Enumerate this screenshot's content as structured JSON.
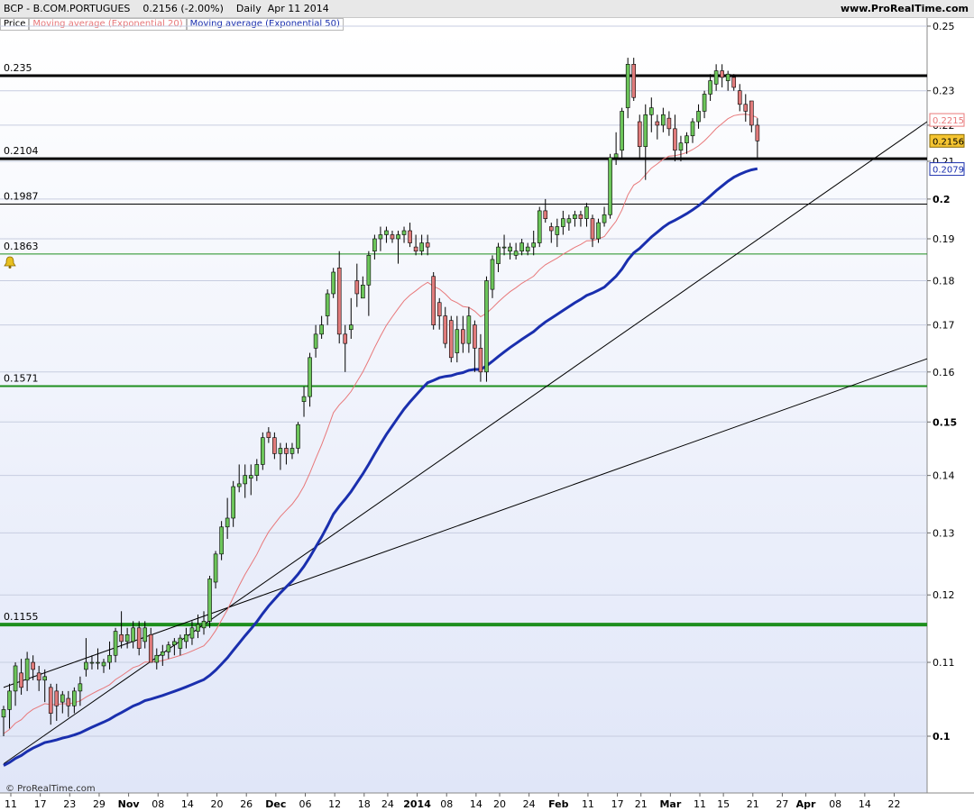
{
  "header": {
    "symbol": "BCP - B.COM.PORTUGUES",
    "last": "0.2156 (-2.00%)",
    "period": "Daily  Apr 11 2014",
    "site": "www.ProRealTime.com"
  },
  "legend": {
    "price": "Price",
    "ema20": "Moving average (Exponential 20)",
    "ema50": "Moving average (Exponential 50)"
  },
  "watermark": "© ProRealTime.com",
  "colors": {
    "bull": "#6cc55a",
    "bear": "#e07b7b",
    "ema20": "#e8787a",
    "ema50": "#1a2fae",
    "support": "#1e8f1e",
    "resistance": "#000000",
    "trendline": "#000000",
    "plot_bg_top": "#ffffff",
    "plot_bg_bottom": "#e0e6f8"
  },
  "chart_data": {
    "type": "candlestick",
    "scale": "log",
    "ylim": [
      0.095,
      0.25
    ],
    "y_ticks": [
      "0.25",
      "0.23",
      "0.22",
      "0.21",
      "0.2",
      "0.19",
      "0.18",
      "0.17",
      "0.16",
      "0.15",
      "0.14",
      "0.13",
      "0.12",
      "0.11",
      "0.1"
    ],
    "x_ticks": [
      "11",
      "17",
      "23",
      "29",
      "Nov",
      "08",
      "14",
      "20",
      "26",
      "Dec",
      "06",
      "12",
      "18",
      "24",
      "2014",
      "08",
      "14",
      "20",
      "24",
      "Feb",
      "11",
      "17",
      "21",
      "Mar",
      "11",
      "15",
      "21",
      "27",
      "Apr",
      "08",
      "14",
      "22"
    ],
    "x_ticks_major": [
      "Nov",
      "Dec",
      "2014",
      "Feb",
      "Mar",
      "Apr"
    ],
    "last_price": 0.2156,
    "ema20_last": 0.2215,
    "ema50_last": 0.2079,
    "levels": [
      {
        "label": "0.235",
        "value": 0.2345,
        "type": "resistance"
      },
      {
        "label": "0.2104",
        "value": 0.2107,
        "type": "resistance"
      },
      {
        "label": "0.1987",
        "value": 0.1987,
        "type": "resistance"
      },
      {
        "label": "0.1863",
        "value": 0.1863,
        "type": "support"
      },
      {
        "label": "0.1571",
        "value": 0.1571,
        "type": "support"
      },
      {
        "label": "0.1155",
        "value": 0.1155,
        "type": "support"
      }
    ],
    "trendlines": [
      {
        "from": [
          0,
          0.0965
        ],
        "to": [
          174,
          0.242
        ]
      },
      {
        "from": [
          0,
          0.1065
        ],
        "to": [
          174,
          0.1705
        ]
      }
    ],
    "tick_positions": [
      0,
      5,
      10,
      15,
      20,
      25,
      30,
      35,
      40,
      45,
      50,
      55,
      60,
      64,
      69,
      74,
      79,
      83,
      88,
      93,
      98,
      103,
      107,
      112,
      117,
      121,
      126,
      131,
      135,
      140,
      145,
      150
    ],
    "candles_series": [
      {
        "name": "Oct",
        "values": [
          [
            0.1025,
            0.104,
            0.1,
            0.1035
          ],
          [
            0.1035,
            0.107,
            0.101,
            0.106
          ],
          [
            0.106,
            0.11,
            0.104,
            0.1095
          ],
          [
            0.1085,
            0.1105,
            0.1055,
            0.1065
          ],
          [
            0.1075,
            0.1115,
            0.106,
            0.1105
          ],
          [
            0.11,
            0.111,
            0.1075,
            0.109
          ],
          [
            0.1085,
            0.1095,
            0.106,
            0.1075
          ],
          [
            0.1075,
            0.109,
            0.1045,
            0.108
          ],
          [
            0.1065,
            0.107,
            0.1015,
            0.103
          ],
          [
            0.106,
            0.107,
            0.102,
            0.104
          ],
          [
            0.1045,
            0.106,
            0.103,
            0.1055
          ],
          [
            0.105,
            0.106,
            0.1025,
            0.104
          ],
          [
            0.104,
            0.1065,
            0.103,
            0.106
          ],
          [
            0.106,
            0.108,
            0.104,
            0.107
          ]
        ]
      },
      {
        "name": "Nov",
        "values": [
          [
            0.109,
            0.1135,
            0.108,
            0.11
          ],
          [
            0.11,
            0.111,
            0.109,
            0.11
          ],
          [
            0.11,
            0.112,
            0.109,
            0.11
          ],
          [
            0.1095,
            0.1105,
            0.1085,
            0.11
          ],
          [
            0.11,
            0.113,
            0.109,
            0.111
          ],
          [
            0.111,
            0.115,
            0.11,
            0.1145
          ],
          [
            0.114,
            0.1175,
            0.112,
            0.113
          ],
          [
            0.113,
            0.115,
            0.112,
            0.114
          ],
          [
            0.113,
            0.116,
            0.112,
            0.115
          ],
          [
            0.115,
            0.116,
            0.111,
            0.112
          ],
          [
            0.113,
            0.116,
            0.112,
            0.115
          ],
          [
            0.114,
            0.115,
            0.11,
            0.11
          ],
          [
            0.11,
            0.112,
            0.109,
            0.111
          ],
          [
            0.111,
            0.1125,
            0.1095,
            0.1115
          ],
          [
            0.1115,
            0.113,
            0.1105,
            0.1125
          ],
          [
            0.1125,
            0.1135,
            0.111,
            0.113
          ],
          [
            0.112,
            0.114,
            0.111,
            0.1135
          ],
          [
            0.113,
            0.115,
            0.112,
            0.114
          ],
          [
            0.1135,
            0.116,
            0.1125,
            0.115
          ],
          [
            0.1145,
            0.117,
            0.1135,
            0.1155
          ],
          [
            0.115,
            0.1175,
            0.114,
            0.116
          ],
          [
            0.116,
            0.123,
            0.115,
            0.1225
          ]
        ]
      },
      {
        "name": "Dec",
        "values": [
          [
            0.122,
            0.127,
            0.121,
            0.1265
          ],
          [
            0.1265,
            0.132,
            0.1255,
            0.131
          ],
          [
            0.131,
            0.136,
            0.129,
            0.1325
          ],
          [
            0.1325,
            0.139,
            0.131,
            0.138
          ],
          [
            0.138,
            0.142,
            0.137,
            0.1385
          ],
          [
            0.1385,
            0.142,
            0.136,
            0.14
          ],
          [
            0.1395,
            0.142,
            0.1365,
            0.14
          ],
          [
            0.14,
            0.143,
            0.139,
            0.142
          ],
          [
            0.142,
            0.148,
            0.141,
            0.147
          ],
          [
            0.148,
            0.149,
            0.146,
            0.147
          ],
          [
            0.147,
            0.148,
            0.143,
            0.144
          ],
          [
            0.144,
            0.146,
            0.141,
            0.145
          ],
          [
            0.145,
            0.146,
            0.142,
            0.144
          ],
          [
            0.144,
            0.146,
            0.143,
            0.145
          ],
          [
            0.145,
            0.15,
            0.144,
            0.1495
          ],
          [
            0.154,
            0.157,
            0.151,
            0.155
          ],
          [
            0.155,
            0.164,
            0.153,
            0.163
          ],
          [
            0.165,
            0.17,
            0.163,
            0.168
          ],
          [
            0.168,
            0.172,
            0.167,
            0.17
          ]
        ]
      },
      {
        "name": "Jan",
        "values": [
          [
            0.172,
            0.178,
            0.17,
            0.177
          ],
          [
            0.177,
            0.183,
            0.176,
            0.182
          ],
          [
            0.183,
            0.187,
            0.166,
            0.168
          ],
          [
            0.168,
            0.17,
            0.16,
            0.166
          ],
          [
            0.169,
            0.176,
            0.167,
            0.17
          ],
          [
            0.18,
            0.184,
            0.174,
            0.177
          ],
          [
            0.176,
            0.181,
            0.176,
            0.179
          ],
          [
            0.179,
            0.187,
            0.172,
            0.186
          ],
          [
            0.187,
            0.191,
            0.185,
            0.19
          ],
          [
            0.19,
            0.193,
            0.187,
            0.191
          ],
          [
            0.191,
            0.193,
            0.189,
            0.192
          ],
          [
            0.191,
            0.192,
            0.189,
            0.19
          ],
          [
            0.19,
            0.192,
            0.184,
            0.191
          ],
          [
            0.191,
            0.193,
            0.189,
            0.192
          ],
          [
            0.192,
            0.194,
            0.188,
            0.189
          ],
          [
            0.188,
            0.191,
            0.186,
            0.187
          ],
          [
            0.187,
            0.191,
            0.186,
            0.189
          ],
          [
            0.189,
            0.191,
            0.186,
            0.188
          ],
          [
            0.181,
            0.182,
            0.169,
            0.17
          ],
          [
            0.175,
            0.176,
            0.169,
            0.172
          ],
          [
            0.172,
            0.174,
            0.165,
            0.166
          ],
          [
            0.171,
            0.172,
            0.162,
            0.163
          ],
          [
            0.164,
            0.172,
            0.162,
            0.169
          ],
          [
            0.169,
            0.172,
            0.164,
            0.166
          ]
        ]
      },
      {
        "name": "Feb",
        "values": [
          [
            0.166,
            0.174,
            0.164,
            0.172
          ],
          [
            0.17,
            0.171,
            0.16,
            0.165
          ],
          [
            0.165,
            0.168,
            0.158,
            0.16
          ],
          [
            0.16,
            0.181,
            0.158,
            0.18
          ],
          [
            0.178,
            0.186,
            0.176,
            0.185
          ],
          [
            0.184,
            0.189,
            0.182,
            0.188
          ],
          [
            0.188,
            0.191,
            0.186,
            0.188
          ],
          [
            0.187,
            0.189,
            0.185,
            0.188
          ],
          [
            0.186,
            0.189,
            0.185,
            0.187
          ],
          [
            0.187,
            0.19,
            0.186,
            0.189
          ],
          [
            0.187,
            0.189,
            0.186,
            0.188
          ],
          [
            0.188,
            0.192,
            0.186,
            0.189
          ],
          [
            0.189,
            0.198,
            0.188,
            0.197
          ],
          [
            0.197,
            0.2,
            0.194,
            0.195
          ],
          [
            0.193,
            0.194,
            0.189,
            0.192
          ],
          [
            0.191,
            0.195,
            0.188,
            0.193
          ],
          [
            0.193,
            0.197,
            0.191,
            0.195
          ],
          [
            0.194,
            0.196,
            0.192,
            0.195
          ],
          [
            0.195,
            0.197,
            0.193,
            0.196
          ],
          [
            0.196,
            0.197,
            0.193,
            0.195
          ]
        ]
      },
      {
        "name": "Mar",
        "values": [
          [
            0.195,
            0.199,
            0.193,
            0.198
          ],
          [
            0.195,
            0.196,
            0.188,
            0.19
          ],
          [
            0.19,
            0.195,
            0.189,
            0.194
          ],
          [
            0.194,
            0.198,
            0.193,
            0.196
          ],
          [
            0.196,
            0.212,
            0.195,
            0.211
          ],
          [
            0.211,
            0.218,
            0.209,
            0.212
          ],
          [
            0.213,
            0.225,
            0.211,
            0.224
          ],
          [
            0.225,
            0.24,
            0.222,
            0.238
          ],
          [
            0.238,
            0.24,
            0.227,
            0.228
          ],
          [
            0.221,
            0.223,
            0.211,
            0.214
          ],
          [
            0.214,
            0.226,
            0.205,
            0.223
          ],
          [
            0.223,
            0.228,
            0.218,
            0.225
          ],
          [
            0.221,
            0.223,
            0.216,
            0.22
          ],
          [
            0.22,
            0.225,
            0.218,
            0.223
          ],
          [
            0.222,
            0.224,
            0.217,
            0.219
          ],
          [
            0.219,
            0.223,
            0.21,
            0.213
          ],
          [
            0.213,
            0.217,
            0.21,
            0.215
          ],
          [
            0.215,
            0.218,
            0.212,
            0.217
          ],
          [
            0.217,
            0.222,
            0.215,
            0.221
          ]
        ]
      },
      {
        "name": "Apr",
        "values": [
          [
            0.221,
            0.226,
            0.219,
            0.224
          ],
          [
            0.224,
            0.23,
            0.222,
            0.229
          ],
          [
            0.229,
            0.235,
            0.227,
            0.233
          ],
          [
            0.232,
            0.238,
            0.23,
            0.236
          ],
          [
            0.236,
            0.238,
            0.231,
            0.234
          ],
          [
            0.233,
            0.236,
            0.23,
            0.235
          ],
          [
            0.234,
            0.235,
            0.23,
            0.231
          ],
          [
            0.23,
            0.232,
            0.224,
            0.226
          ],
          [
            0.226,
            0.229,
            0.221,
            0.224
          ],
          [
            0.227,
            0.227,
            0.218,
            0.22
          ],
          [
            0.22,
            0.222,
            0.211,
            0.2156
          ]
        ]
      }
    ]
  }
}
